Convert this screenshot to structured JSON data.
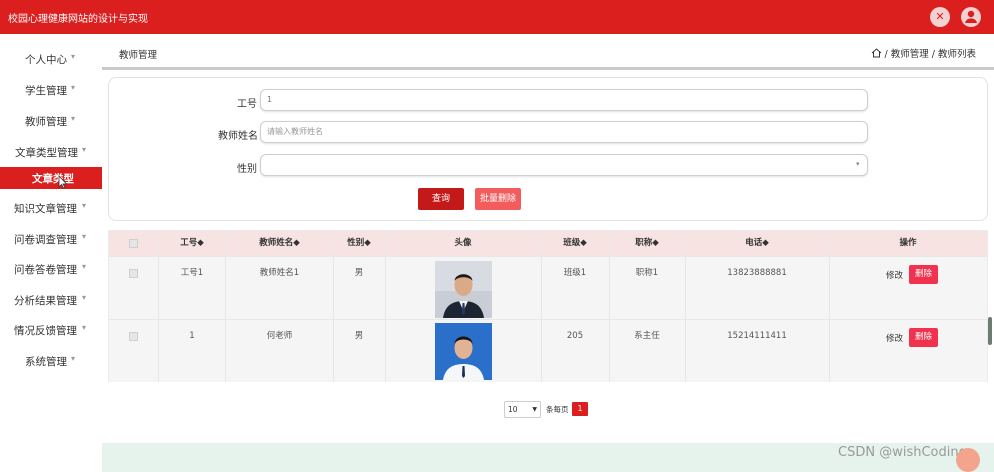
{
  "app": {
    "title": "校园心理健康网站的设计与实现"
  },
  "icons": {
    "close": "close-icon",
    "user": "user-icon",
    "home": "home-icon",
    "caret": "chevron-down-icon"
  },
  "sidebar": {
    "items": [
      {
        "label": "个人中心",
        "caret": "▾"
      },
      {
        "label": "学生管理",
        "caret": "▾"
      },
      {
        "label": "教师管理",
        "caret": "▾"
      },
      {
        "label": "文章类型管理",
        "caret": "▾"
      },
      {
        "label": "文章类型",
        "active": true
      },
      {
        "label": "知识文章管理",
        "caret": "▾"
      },
      {
        "label": "问卷调查管理",
        "caret": "▾"
      },
      {
        "label": "问卷答卷管理",
        "caret": "▾"
      },
      {
        "label": "分析结果管理",
        "caret": "▾"
      },
      {
        "label": "情况反馈管理",
        "caret": "▾"
      },
      {
        "label": "系统管理",
        "caret": "▾"
      }
    ]
  },
  "breadcrumb": {
    "title": "教师管理",
    "path": "/ 教师管理 / 教师列表"
  },
  "search": {
    "id_label": "工号",
    "id_value": "1",
    "name_label": "教师姓名",
    "name_placeholder": "请输入教师姓名",
    "gender_label": "性别",
    "query_button": "查询",
    "batch_delete_button": "批量删除"
  },
  "table": {
    "headers": [
      "工号◆",
      "教师姓名◆",
      "性别◆",
      "头像",
      "班级◆",
      "职称◆",
      "电话◆",
      "操作"
    ],
    "rows": [
      {
        "id": "工号1",
        "name": "教师姓名1",
        "gender": "男",
        "class": "班级1",
        "title": "职称1",
        "phone": "13823888881",
        "edit": "修改",
        "delete": "删除"
      },
      {
        "id": "1",
        "name": "何老师",
        "gender": "男",
        "class": "205",
        "title": "系主任",
        "phone": "15214111411",
        "edit": "修改",
        "delete": "删除"
      }
    ]
  },
  "pagination": {
    "page_size": "10",
    "per_page_label": "条每页",
    "current_page": "1"
  },
  "watermark": "CSDN @wishCoding",
  "colors": {
    "brand": "#db1e1e",
    "delete": "#f0324e",
    "header_bg": "#f8e3e3"
  }
}
